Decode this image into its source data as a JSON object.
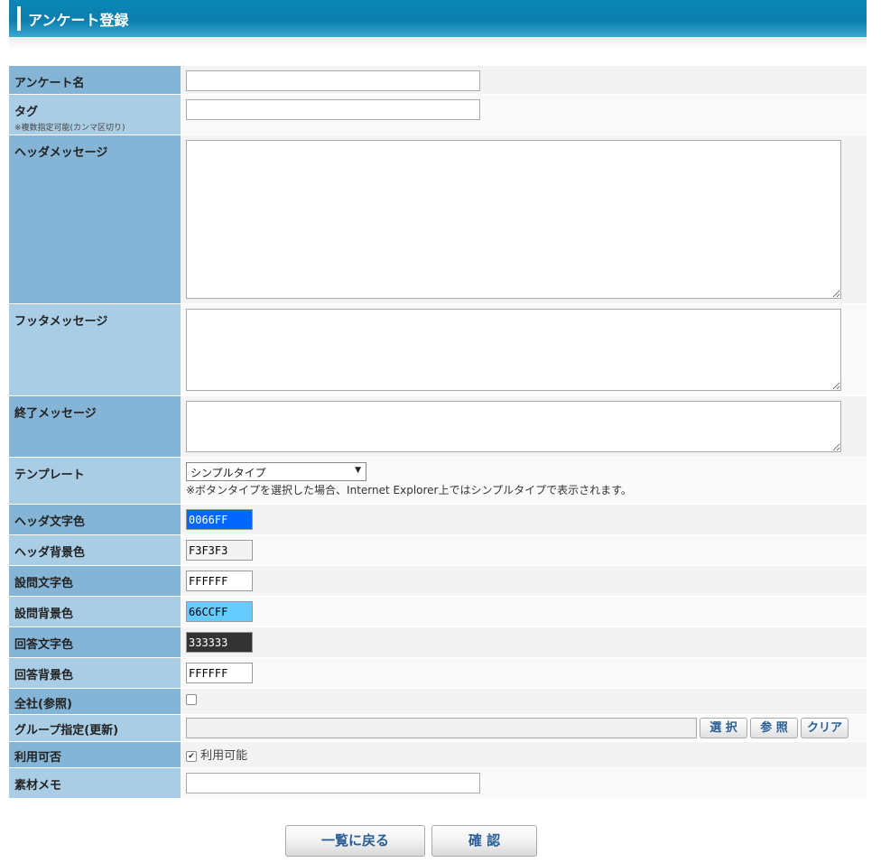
{
  "header": {
    "title": "アンケート登録"
  },
  "form": {
    "survey_name": {
      "label": "アンケート名",
      "value": ""
    },
    "tags": {
      "label": "タグ",
      "sublabel": "※複数指定可能(カンマ区切り)",
      "value": ""
    },
    "header_message": {
      "label": "ヘッダメッセージ",
      "value": ""
    },
    "footer_message": {
      "label": "フッタメッセージ",
      "value": ""
    },
    "end_message": {
      "label": "終了メッセージ",
      "value": ""
    },
    "template": {
      "label": "テンプレート",
      "selected": "シンプルタイプ",
      "note": "※ボタンタイプを選択した場合、Internet Explorer上ではシンプルタイプで表示されます。"
    },
    "header_text_color": {
      "label": "ヘッダ文字色",
      "value": "0066FF",
      "bg": "#0066FF",
      "fg": "#FFFFFF"
    },
    "header_bg_color": {
      "label": "ヘッダ背景色",
      "value": "F3F3F3",
      "bg": "#F3F3F3",
      "fg": "#000000"
    },
    "question_text_color": {
      "label": "設問文字色",
      "value": "FFFFFF",
      "bg": "#FFFFFF",
      "fg": "#000000"
    },
    "question_bg_color": {
      "label": "設問背景色",
      "value": "66CCFF",
      "bg": "#66CCFF",
      "fg": "#000000"
    },
    "answer_text_color": {
      "label": "回答文字色",
      "value": "333333",
      "bg": "#333333",
      "fg": "#FFFFFF"
    },
    "answer_bg_color": {
      "label": "回答背景色",
      "value": "FFFFFF",
      "bg": "#FFFFFF",
      "fg": "#000000"
    },
    "company_wide": {
      "label": "全社(参照)",
      "checked": false
    },
    "group": {
      "label": "グループ指定(更新)",
      "value": "",
      "select_label": "選 択",
      "refer_label": "参 照",
      "clear_label": "クリア"
    },
    "available": {
      "label": "利用可否",
      "checked": true,
      "checkbox_label": "利用可能"
    },
    "material_memo": {
      "label": "素材メモ",
      "value": ""
    }
  },
  "actions": {
    "back_label": "一覧に戻る",
    "confirm_label": "確 認"
  }
}
